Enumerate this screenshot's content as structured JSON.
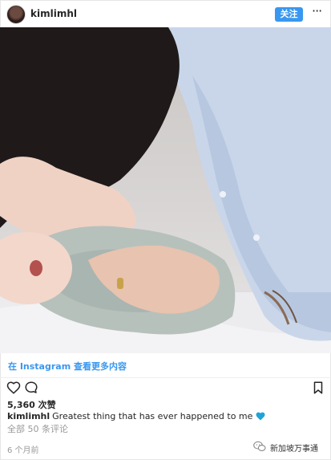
{
  "header": {
    "username": "kimlimhl",
    "follow_label": "关注",
    "more_label": "···"
  },
  "photo": {
    "alt_subject": "mother-and-baby-photo"
  },
  "instagram_link": "在 Instagram 查看更多内容",
  "actions": {
    "like_icon": "heart-outline-icon",
    "comment_icon": "comment-bubble-icon",
    "bookmark_icon": "bookmark-icon"
  },
  "likes_text": "5,360 次赞",
  "caption": {
    "username": "kimlimhl",
    "text": "Greatest thing that has ever happened to me",
    "emoji_icon": "blue-heart-icon",
    "emoji_color": "#1fa3d8"
  },
  "comments_text": "全部 50 条评论",
  "timestamp": "6 个月前",
  "watermark": {
    "text": "新加坡万事通",
    "icon": "wechat-icon"
  },
  "colors": {
    "accent": "#3897f0",
    "muted": "#999999"
  }
}
